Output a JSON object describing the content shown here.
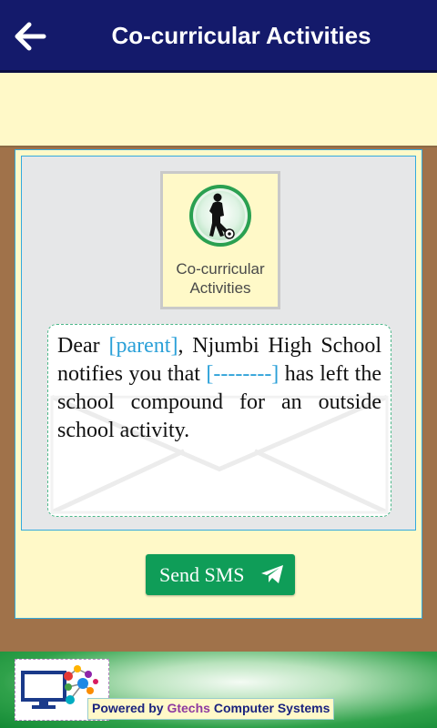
{
  "header": {
    "title": "Co-curricular Activities",
    "back_icon": "arrow-left-icon"
  },
  "tile": {
    "icon": "football-player-icon",
    "label_line1": "Co-curricular",
    "label_line2": "Activities"
  },
  "message": {
    "part1": "Dear ",
    "parent_placeholder": "[parent]",
    "part2": ", Njumbi High School notifies you that ",
    "student_placeholder": "[--------]",
    "part3": " has left the school compound for an outside school activity."
  },
  "send": {
    "label": "Send SMS",
    "icon": "telegram-send-icon"
  },
  "footer": {
    "powered_prefix": "Powered by ",
    "powered_brand": "Gtechs",
    "powered_suffix": " Computer Systems",
    "logo_icon": "computer-network-logo"
  },
  "colors": {
    "topbar": "#141a6b",
    "band": "#fff9c8",
    "frame": "#a0724a",
    "button": "#0f9d58",
    "placeholder": "#2aa0d8"
  }
}
